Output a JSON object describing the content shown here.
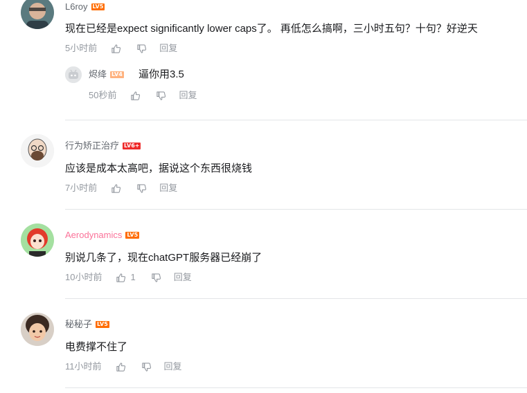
{
  "comments": [
    {
      "user": "L6roy",
      "level": "LV5",
      "text": "现在已经是expect significantly lower caps了。 再低怎么搞啊，三小时五句？十句？好逆天",
      "time": "5小时前",
      "reply_label": "回复",
      "replies": [
        {
          "user": "烬绛",
          "level": "LV4",
          "text": "逼你用3.5",
          "time": "50秒前",
          "reply_label": "回复"
        }
      ]
    },
    {
      "user": "行为矫正治疗",
      "level": "LV6+",
      "text": "应该是成本太高吧，据说这个东西很烧钱",
      "time": "7小时前",
      "reply_label": "回复"
    },
    {
      "user": "Aerodynamics",
      "level": "LV5",
      "text": "别说几条了，现在chatGPT服务器已经崩了",
      "time": "10小时前",
      "likes": "1",
      "reply_label": "回复"
    },
    {
      "user": "秘秘子",
      "level": "LV5",
      "text": "电费撑不住了",
      "time": "11小时前",
      "reply_label": "回复"
    }
  ],
  "colors": {
    "username": "#61666d",
    "username_vip": "#fb7299",
    "meta": "#9499a0",
    "level5": "#ff6c00",
    "level6plus": "#ee2a2a",
    "level4": "#ffb27f",
    "divider": "#e3e5e7"
  },
  "icons": {
    "like": "thumb-up-icon",
    "dislike": "thumb-down-icon"
  }
}
